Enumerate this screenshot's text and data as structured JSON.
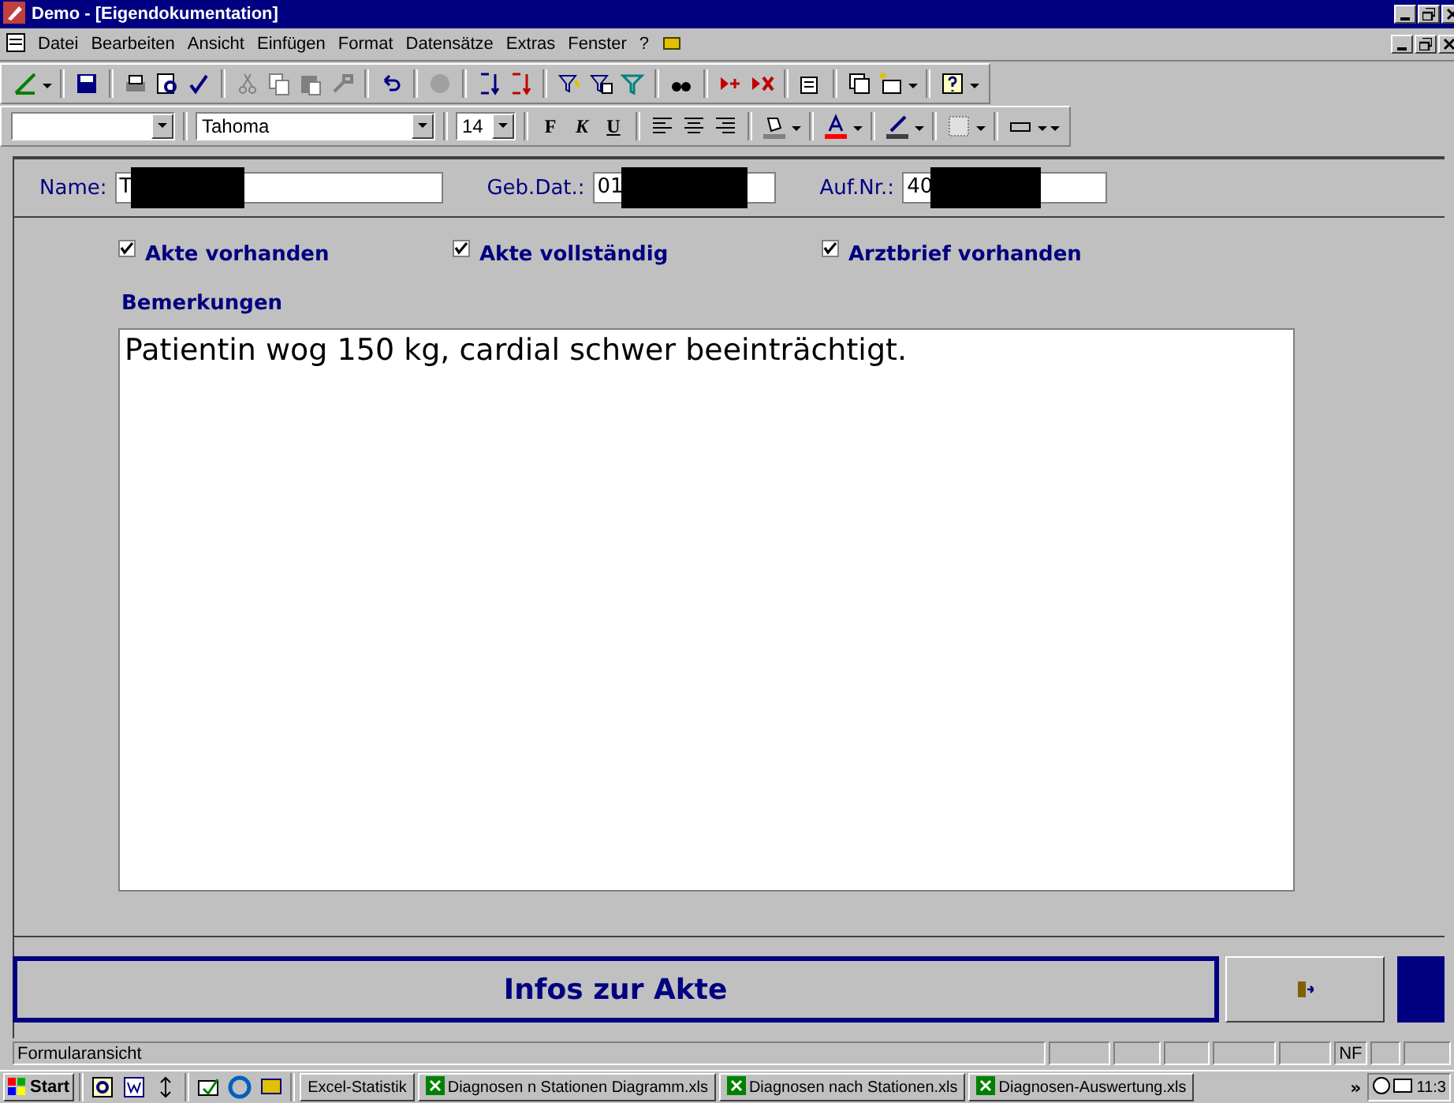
{
  "window": {
    "title": "Demo - [Eigendokumentation]"
  },
  "menu": [
    {
      "label": "Datei"
    },
    {
      "label": "Bearbeiten"
    },
    {
      "label": "Ansicht"
    },
    {
      "label": "Einfügen"
    },
    {
      "label": "Format"
    },
    {
      "label": "Datensätze"
    },
    {
      "label": "Extras"
    },
    {
      "label": "Fenster"
    },
    {
      "label": "?"
    }
  ],
  "format_bar": {
    "font": "Tahoma",
    "size": "14",
    "bold": "F",
    "italic": "K",
    "underline": "U"
  },
  "fields": [
    {
      "label": "Name:",
      "value": "T"
    },
    {
      "label": "Geb.Dat.:",
      "value": "01"
    },
    {
      "label": "Auf.Nr.:",
      "value": "40"
    }
  ],
  "checkboxes": [
    {
      "label": "Akte vorhanden",
      "checked": true
    },
    {
      "label": "Akte vollständig",
      "checked": true
    },
    {
      "label": "Arztbrief vorhanden",
      "checked": true
    }
  ],
  "remarks": {
    "label": "Bemerkungen",
    "value": "Patientin wog 150 kg, cardial schwer beeinträchtigt."
  },
  "footer": {
    "button": "Infos zur Akte"
  },
  "status_bar": {
    "text": "Formularansicht",
    "indicator": "NF"
  },
  "taskbar": {
    "start": "Start",
    "tasks": [
      {
        "label": "Excel-Statistik",
        "icon": false
      },
      {
        "label": "Diagnosen n Stationen Diagramm.xls",
        "icon": true
      },
      {
        "label": "Diagnosen nach Stationen.xls",
        "icon": true
      },
      {
        "label": "Diagnosen-Auswertung.xls",
        "icon": true
      }
    ],
    "more": "»",
    "clock": "11:3"
  }
}
